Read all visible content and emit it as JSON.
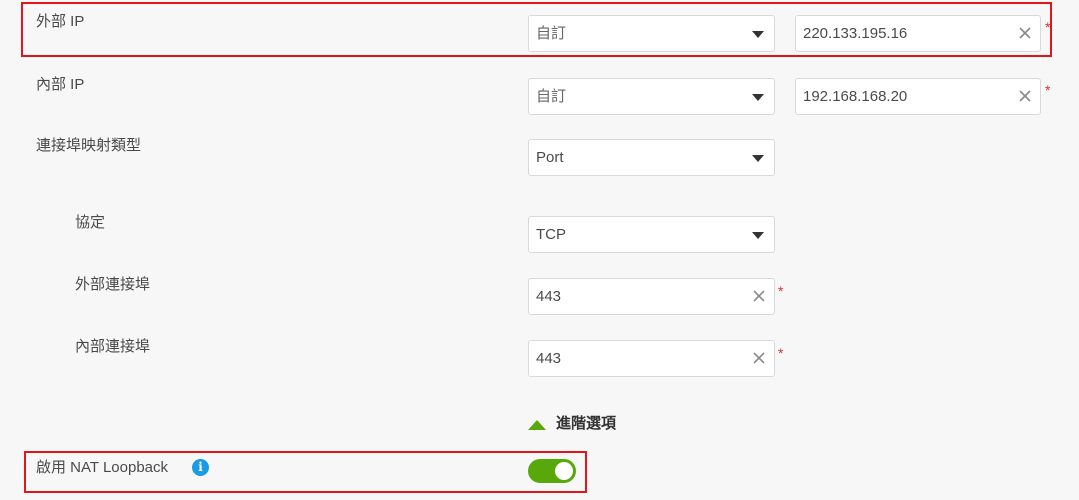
{
  "rows": {
    "external_ip": {
      "label": "外部 IP",
      "mode": "自訂",
      "value": "220.133.195.16",
      "required": "*"
    },
    "internal_ip": {
      "label": "內部 IP",
      "mode": "自訂",
      "value": "192.168.168.20",
      "required": "*"
    },
    "port_mapping_type": {
      "label": "連接埠映射類型",
      "value": "Port"
    },
    "protocol": {
      "label": "協定",
      "value": "TCP"
    },
    "external_port": {
      "label": "外部連接埠",
      "value": "443",
      "required": "*"
    },
    "internal_port": {
      "label": "內部連接埠",
      "value": "443",
      "required": "*"
    }
  },
  "advanced": {
    "label": "進階選項"
  },
  "nat_loopback": {
    "label": "啟用 NAT Loopback",
    "enabled": true,
    "info_icon": "info-icon"
  },
  "colors": {
    "accent": "#58a80c",
    "highlight": "#e0161b",
    "required": "#e0302a",
    "info": "#1a9be6"
  }
}
